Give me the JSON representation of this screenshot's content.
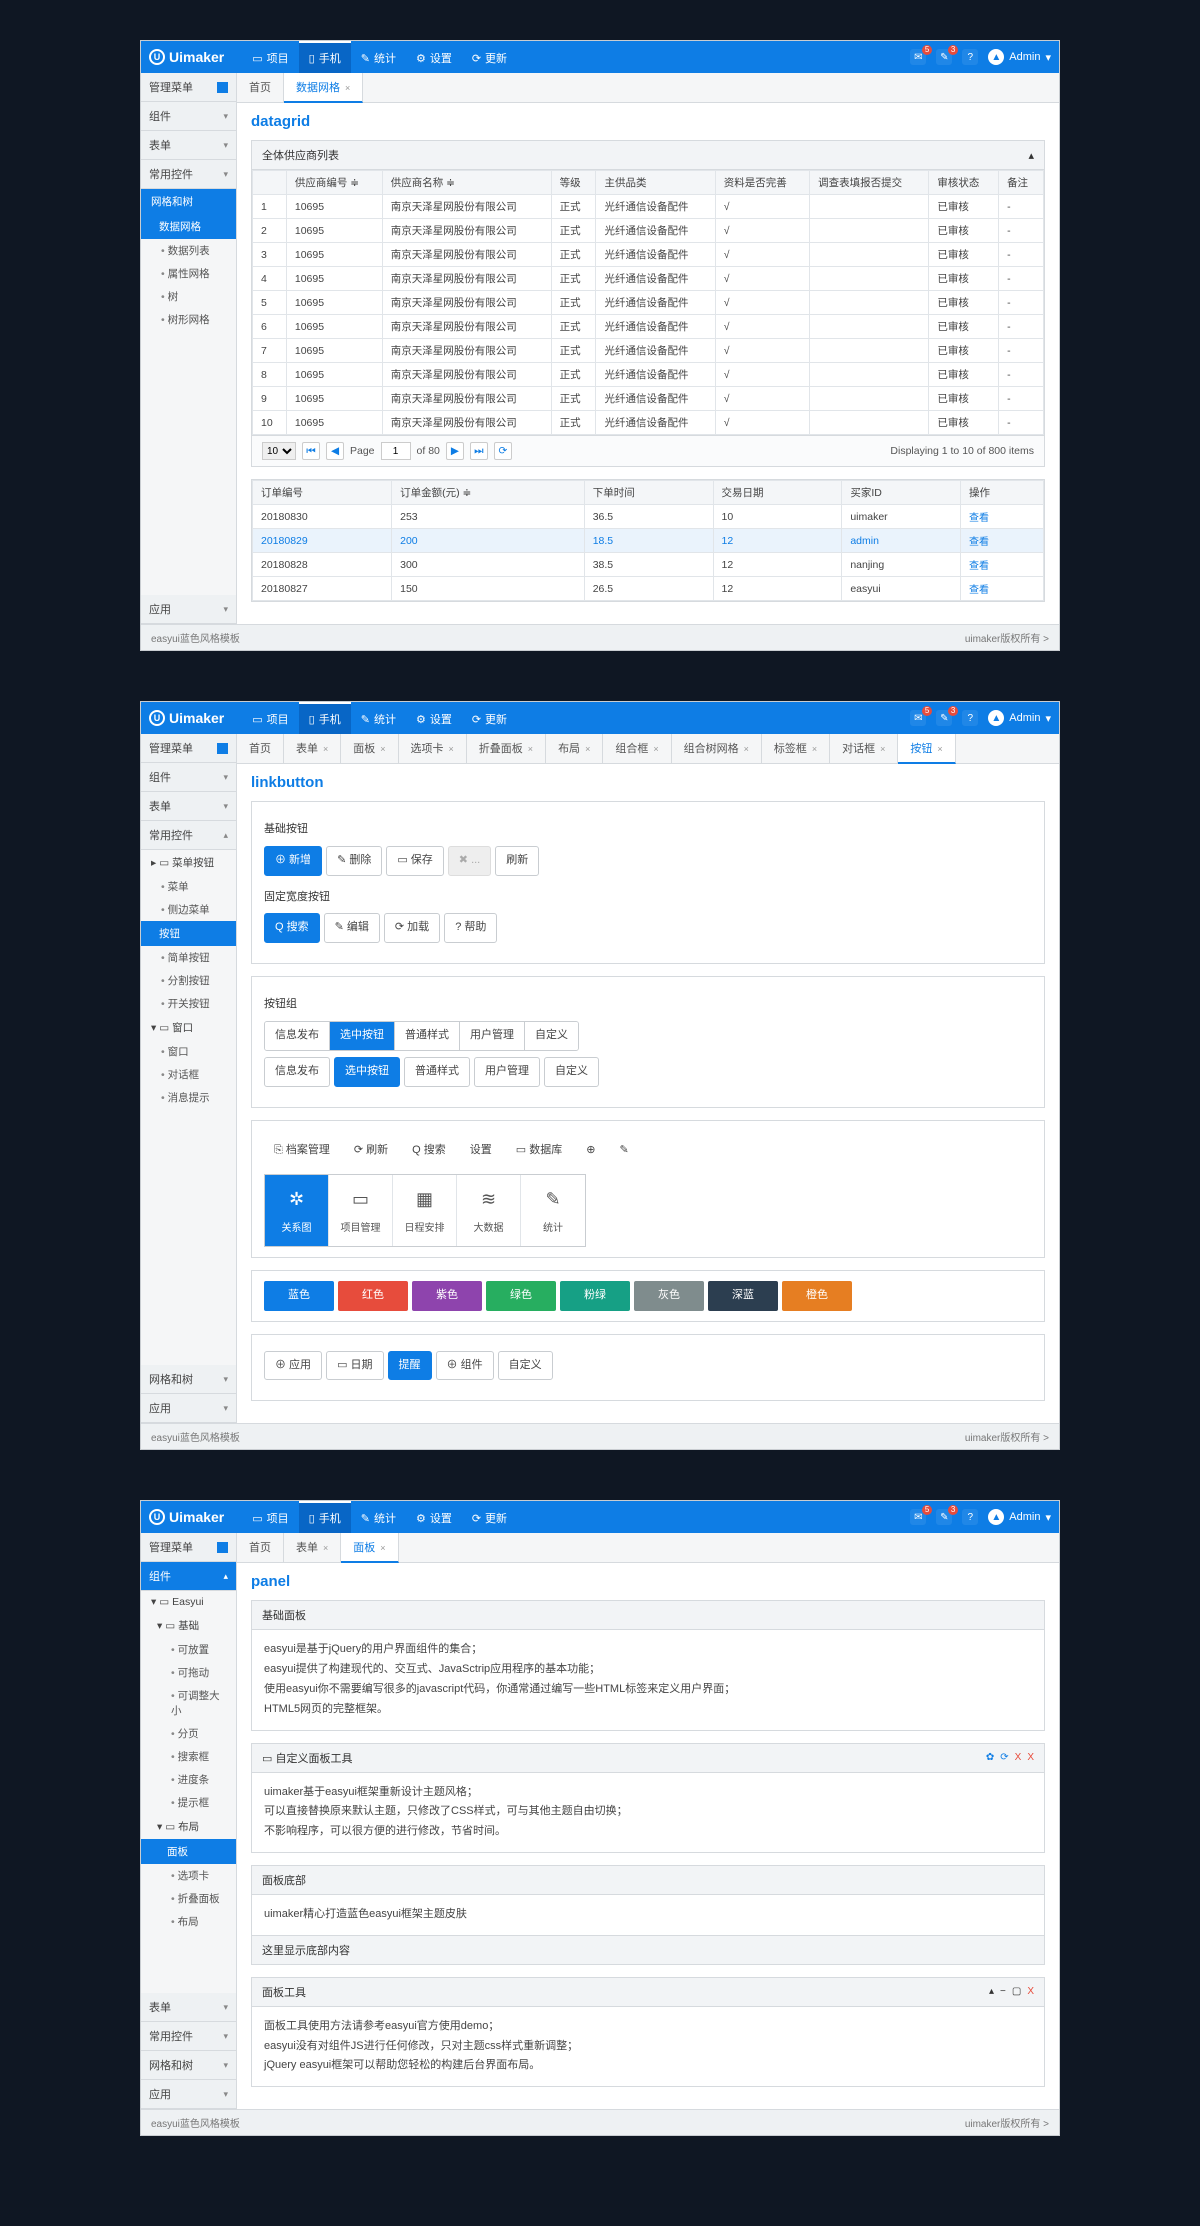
{
  "common": {
    "brand": "Uimaker",
    "footer_left": "easyui蓝色风格模板",
    "footer_right": "uimaker版权所有 >",
    "user": "Admin",
    "badges": {
      "msg": "5",
      "chat": "3"
    },
    "topnav": [
      {
        "label": "项目",
        "icon": "▭"
      },
      {
        "label": "手机",
        "icon": "▯",
        "active": true
      },
      {
        "label": "统计",
        "icon": "✎"
      },
      {
        "label": "设置",
        "icon": "⚙"
      },
      {
        "label": "更新",
        "icon": "⟳"
      }
    ]
  },
  "s1": {
    "side_headers": {
      "mgmt": "管理菜单",
      "comp": "组件",
      "form": "表单",
      "common": "常用控件",
      "app": "应用"
    },
    "side_tree": {
      "active1": "网格和树",
      "active2": "数据网格",
      "items": [
        "数据列表",
        "属性网格",
        "树",
        "树形网格"
      ]
    },
    "tabs": [
      {
        "label": "首页"
      },
      {
        "label": "数据网格",
        "active": true,
        "closable": true
      }
    ],
    "page_title": "datagrid",
    "panel_title": "全体供应商列表",
    "columns": [
      "",
      "供应商编号 ≑",
      "供应商名称 ≑",
      "等级",
      "主供品类",
      "资料是否完善",
      "调查表填报否提交",
      "审核状态",
      "备注"
    ],
    "rows": [
      [
        "1",
        "10695",
        "南京天泽星网股份有限公司",
        "正式",
        "光纤通信设备配件",
        "√",
        "",
        "已审核",
        "-"
      ],
      [
        "2",
        "10695",
        "南京天泽星网股份有限公司",
        "正式",
        "光纤通信设备配件",
        "√",
        "",
        "已审核",
        "-"
      ],
      [
        "3",
        "10695",
        "南京天泽星网股份有限公司",
        "正式",
        "光纤通信设备配件",
        "√",
        "",
        "已审核",
        "-"
      ],
      [
        "4",
        "10695",
        "南京天泽星网股份有限公司",
        "正式",
        "光纤通信设备配件",
        "√",
        "",
        "已审核",
        "-"
      ],
      [
        "5",
        "10695",
        "南京天泽星网股份有限公司",
        "正式",
        "光纤通信设备配件",
        "√",
        "",
        "已审核",
        "-"
      ],
      [
        "6",
        "10695",
        "南京天泽星网股份有限公司",
        "正式",
        "光纤通信设备配件",
        "√",
        "",
        "已审核",
        "-"
      ],
      [
        "7",
        "10695",
        "南京天泽星网股份有限公司",
        "正式",
        "光纤通信设备配件",
        "√",
        "",
        "已审核",
        "-"
      ],
      [
        "8",
        "10695",
        "南京天泽星网股份有限公司",
        "正式",
        "光纤通信设备配件",
        "√",
        "",
        "已审核",
        "-"
      ],
      [
        "9",
        "10695",
        "南京天泽星网股份有限公司",
        "正式",
        "光纤通信设备配件",
        "√",
        "",
        "已审核",
        "-"
      ],
      [
        "10",
        "10695",
        "南京天泽星网股份有限公司",
        "正式",
        "光纤通信设备配件",
        "√",
        "",
        "已审核",
        "-"
      ]
    ],
    "pager": {
      "size": "10",
      "page": "1",
      "total": "80",
      "info": "Displaying 1 to 10 of 800 items"
    },
    "cols2": [
      "订单编号",
      "订单金额(元) ≑",
      "下单时间",
      "交易日期",
      "买家ID",
      "操作"
    ],
    "rows2": [
      {
        "d": [
          "20180830",
          "253",
          "36.5",
          "10",
          "uimaker",
          "查看"
        ]
      },
      {
        "d": [
          "20180829",
          "200",
          "18.5",
          "12",
          "admin",
          "查看"
        ],
        "sel": true
      },
      {
        "d": [
          "20180828",
          "300",
          "38.5",
          "12",
          "nanjing",
          "查看"
        ]
      },
      {
        "d": [
          "20180827",
          "150",
          "26.5",
          "12",
          "easyui",
          "查看"
        ]
      }
    ]
  },
  "s2": {
    "side_headers": {
      "mgmt": "管理菜单",
      "comp": "组件",
      "form": "表单",
      "common": "常用控件",
      "tree": "网格和树",
      "app": "应用"
    },
    "groups": {
      "menu_btn": "菜单按钮",
      "menu": "菜单",
      "side_menu": "侧边菜单",
      "button": "按钮",
      "simple_btn": "简单按钮",
      "split_btn": "分割按钮",
      "switch_btn": "开关按钮",
      "window": "窗口",
      "win": "窗口",
      "dialog": "对话框",
      "msg": "消息提示"
    },
    "tabs": [
      "首页",
      "表单",
      "面板",
      "选项卡",
      "折叠面板",
      "布局",
      "组合框",
      "组合树网格",
      "标签框",
      "对话框",
      "按钮"
    ],
    "page_title": "linkbutton",
    "labels": {
      "basic": "基础按钮",
      "fixed": "固定宽度按钮",
      "group": "按钮组"
    },
    "basic_btns": [
      {
        "t": "⊕ 新增",
        "cls": "primary"
      },
      {
        "t": "✎ 删除"
      },
      {
        "t": "▭ 保存"
      },
      {
        "t": "✖ ...",
        "cls": "disabled"
      },
      {
        "t": "刷新"
      }
    ],
    "fixed_btns": [
      {
        "t": "Q 搜索",
        "cls": "primary"
      },
      {
        "t": "✎ 编辑"
      },
      {
        "t": "⟳ 加载"
      },
      {
        "t": "? 帮助"
      }
    ],
    "seg1": [
      "信息发布",
      "选中按钮",
      "普通样式",
      "用户管理",
      "自定义"
    ],
    "seg2": [
      "信息发布",
      "选中按钮",
      "普通样式",
      "用户管理",
      "自定义"
    ],
    "toolbar": [
      "⎘ 档案管理",
      "⟳ 刷新",
      "Q 搜索",
      "设置",
      "▭ 数据库",
      "⊕",
      "✎"
    ],
    "big": [
      {
        "icon": "✲",
        "label": "关系图",
        "on": true
      },
      {
        "icon": "▭",
        "label": "项目管理"
      },
      {
        "icon": "▦",
        "label": "日程安排"
      },
      {
        "icon": "≋",
        "label": "大数据"
      },
      {
        "icon": "✎",
        "label": "统计"
      }
    ],
    "colors": [
      {
        "t": "蓝色",
        "c": "#0e7de5"
      },
      {
        "t": "红色",
        "c": "#e74c3c"
      },
      {
        "t": "紫色",
        "c": "#8e44ad"
      },
      {
        "t": "绿色",
        "c": "#27ae60"
      },
      {
        "t": "粉绿",
        "c": "#16a085"
      },
      {
        "t": "灰色",
        "c": "#7f8c8d"
      },
      {
        "t": "深蓝",
        "c": "#2c3e50"
      },
      {
        "t": "橙色",
        "c": "#e67e22"
      }
    ],
    "last_row": [
      "⊕ 应用",
      "▭ 日期",
      "提醒",
      "⊕ 组件",
      "自定义"
    ]
  },
  "s3": {
    "side_headers": {
      "mgmt": "管理菜单",
      "comp": "组件",
      "form": "表单",
      "common": "常用控件",
      "tree": "网格和树",
      "app": "应用"
    },
    "tree": {
      "easyui": "Easyui",
      "base": "基础",
      "base_items": [
        "可放置",
        "可拖动",
        "可调整大小",
        "分页",
        "搜索框",
        "进度条",
        "提示框"
      ],
      "layout": "布局",
      "panel": "面板",
      "layout_items": [
        "选项卡",
        "折叠面板",
        "布局"
      ]
    },
    "tabs": [
      "首页",
      "表单",
      "面板"
    ],
    "page_title": "panel",
    "p1": {
      "title": "基础面板",
      "l1": "easyui是基于jQuery的用户界面组件的集合；",
      "l2": "easyui提供了构建现代的、交互式、JavaSctrip应用程序的基本功能；",
      "l3": "使用easyui你不需要编写很多的javascript代码，你通常通过编写一些HTML标签来定义用户界面；",
      "l4": "HTML5网页的完整框架。"
    },
    "p2": {
      "title": "▭ 自定义面板工具",
      "l1": "uimaker基于easyui框架重新设计主题风格；",
      "l2": "可以直接替换原来默认主题，只修改了CSS样式，可与其他主题自由切换；",
      "l3": "不影响程序，可以很方便的进行修改，节省时间。"
    },
    "p3": {
      "title": "面板底部",
      "l1": "uimaker精心打造蓝色easyui框架主题皮肤",
      "f": "这里显示底部内容"
    },
    "p4": {
      "title": "面板工具",
      "l1": "面板工具使用方法请参考easyui官方使用demo；",
      "l2": "easyui没有对组件JS进行任何修改，只对主题css样式重新调整；",
      "l3": "jQuery easyui框架可以帮助您轻松的构建后台界面布局。"
    }
  }
}
